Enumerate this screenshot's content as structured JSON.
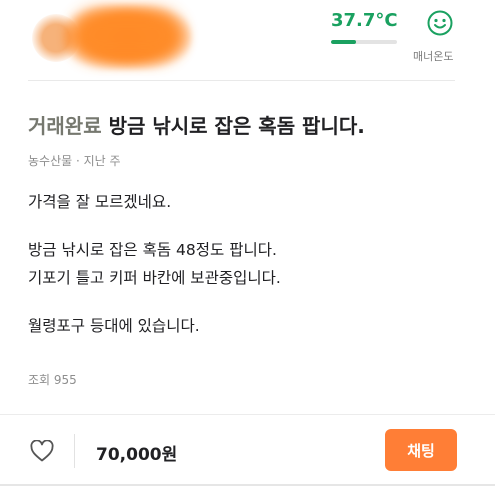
{
  "profile": {
    "manner_temperature": "37.7°C",
    "manner_level": 0.377,
    "manner_label": "매너온도",
    "accent_color": "#1aa160"
  },
  "post": {
    "status": "거래완료",
    "title": "방금 낚시로 잡은 혹돔 팝니다.",
    "category_time": "농수산물 · 지난 주",
    "description": [
      "가격을 잘 모르겠네요.",
      "방금 낚시로 잡은 혹돔 48정도 팝니다.",
      "기포기 틀고 키퍼 바칸에 보관중입니다.",
      "월령포구 등대에 있습니다."
    ],
    "views": "조회 955"
  },
  "bottom_bar": {
    "price": "70,000원",
    "chat_label": "채팅",
    "chat_color": "#ff7e36",
    "like_icon": "heart-outline-icon"
  }
}
